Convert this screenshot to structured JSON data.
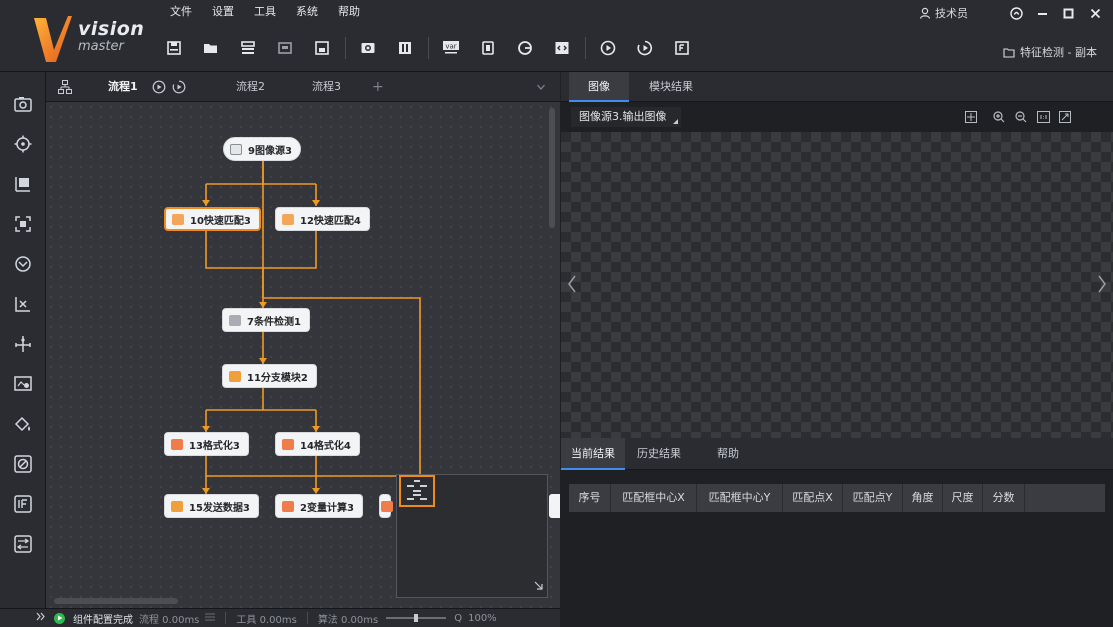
{
  "app": {
    "logo_line1": "vision",
    "logo_line2": "master",
    "accent": "#f08a1c",
    "tab_accent": "#3d8ef0"
  },
  "menu": [
    "文件",
    "设置",
    "工具",
    "系统",
    "帮助"
  ],
  "toolbar": {
    "icons": [
      "save-icon",
      "open-folder-icon",
      "save-as-icon",
      "close-icon",
      "layout-icon",
      "camera-icon",
      "module-grid-icon",
      "variable-icon",
      "io-icon",
      "communication-icon",
      "script-icon",
      "run-once-icon",
      "run-loop-icon",
      "form-icon"
    ]
  },
  "user": {
    "name": "技术员"
  },
  "project": {
    "name": "特征检测 - 副本"
  },
  "flow": {
    "tabs": [
      "流程1",
      "流程2",
      "流程3"
    ],
    "add_tab": "+",
    "nodes": [
      {
        "label": "9图像源3"
      },
      {
        "label": "10快速匹配3"
      },
      {
        "label": "12快速匹配4"
      },
      {
        "label": "7条件检测1"
      },
      {
        "label": "11分支模块2"
      },
      {
        "label": "13格式化3"
      },
      {
        "label": "14格式化4"
      },
      {
        "label": "15发送数据3"
      },
      {
        "label": "2变量计算3"
      }
    ]
  },
  "status": {
    "state": "组件配置完成",
    "flow": "流程 0.00ms",
    "tool": "工具 0.00ms",
    "algo": "算法 0.00ms",
    "zoom": "100%",
    "zoom_icon_glyph": "Q"
  },
  "image_panel": {
    "tabs": [
      "图像",
      "模块结果"
    ],
    "source": "图像源3.输出图像"
  },
  "results_panel": {
    "tabs": [
      "当前结果",
      "历史结果",
      "帮助"
    ],
    "columns": [
      "序号",
      "匹配框中心X",
      "匹配框中心Y",
      "匹配点X",
      "匹配点Y",
      "角度",
      "尺度",
      "分数"
    ]
  }
}
